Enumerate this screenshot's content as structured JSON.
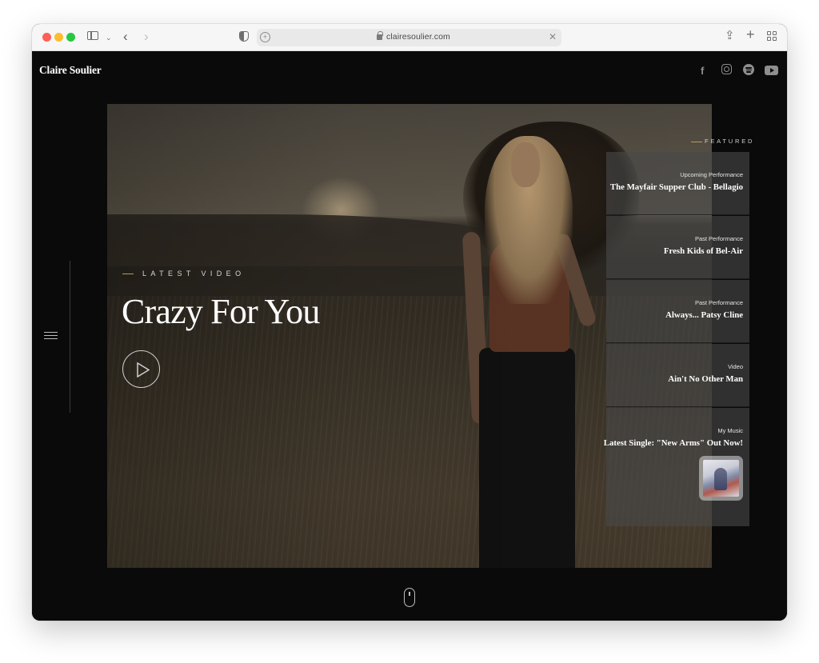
{
  "browser": {
    "url": "clairesoulier.com",
    "icons": [
      "sidebar-icon",
      "chevron-down-icon",
      "back-icon",
      "forward-icon",
      "shield-icon",
      "extension-icon",
      "lock-icon",
      "close-icon",
      "share-icon",
      "plus-icon",
      "tab-overview-icon"
    ]
  },
  "site": {
    "logo": "Claire Soulier",
    "social_icons": [
      "facebook-icon",
      "instagram-icon",
      "spotify-icon",
      "youtube-icon"
    ],
    "facebook_glyph": "f"
  },
  "hero": {
    "eyebrow": "LATEST VIDEO",
    "title": "Crazy For You",
    "play_icon": "play-icon"
  },
  "featured": {
    "label": "FEATURED",
    "items": [
      {
        "category": "Upcoming Performance",
        "title": "The Mayfair Supper Club - Bellagio"
      },
      {
        "category": "Past Performance",
        "title": "Fresh Kids of Bel-Air"
      },
      {
        "category": "Past Performance",
        "title": "Always... Patsy Cline"
      },
      {
        "category": "Video",
        "title": "Ain't No Other Man"
      },
      {
        "category": "My Music",
        "title": "Latest Single: \"New Arms\" Out Now!"
      }
    ]
  },
  "colors": {
    "accent_gold": "#b59a5c",
    "page_bg": "#0a0a0a"
  }
}
